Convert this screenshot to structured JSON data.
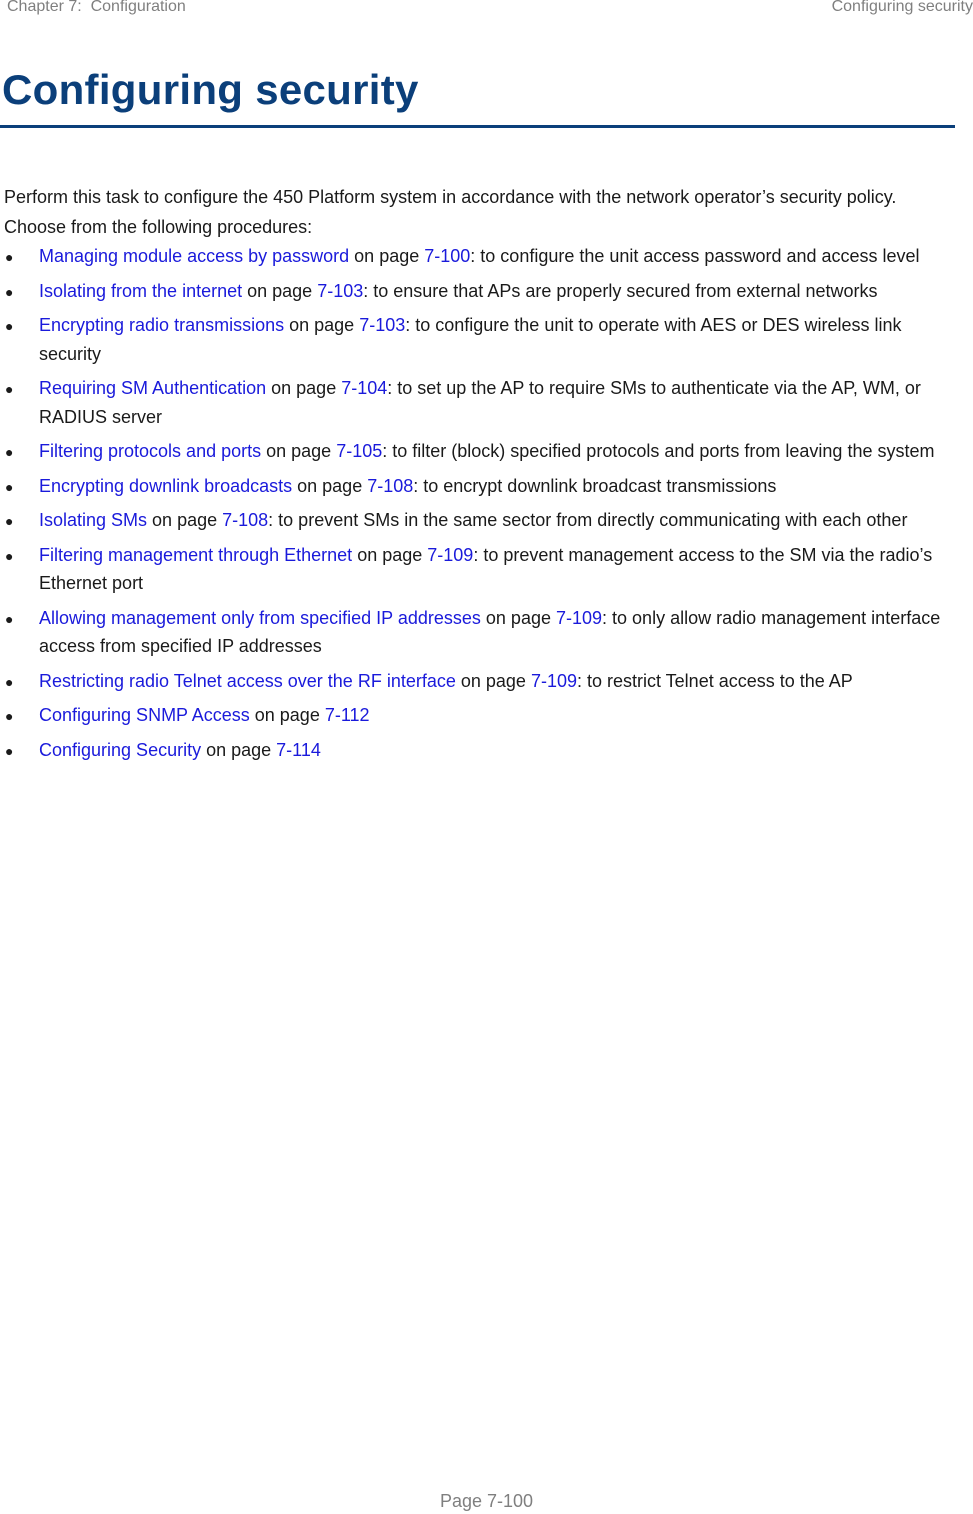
{
  "header": {
    "chapter": "Chapter 7:  Configuration",
    "section": "Configuring security"
  },
  "title": "Configuring security",
  "intro": "Perform this task to configure the 450 Platform system in accordance with the network operator’s security policy. Choose from the following procedures:",
  "on_page_text": " on page ",
  "procedures": [
    {
      "link": "Managing module access by password",
      "page": "7-100",
      "description": ": to configure the unit access password and access level"
    },
    {
      "link": "Isolating from the internet",
      "page": "7-103",
      "description": ": to ensure that APs are properly secured from external networks"
    },
    {
      "link": "Encrypting radio transmissions",
      "page": "7-103",
      "description": ": to configure the unit to operate with AES or DES wireless link security"
    },
    {
      "link": "Requiring SM Authentication",
      "page": "7-104",
      "description": ": to set up the AP to require SMs to authenticate via the AP, WM, or RADIUS server"
    },
    {
      "link": "Filtering protocols and ports",
      "page": "7-105",
      "description": ": to filter (block) specified protocols and ports from leaving the system"
    },
    {
      "link": "Encrypting downlink broadcasts",
      "page": "7-108",
      "description": ": to encrypt downlink broadcast transmissions"
    },
    {
      "link": "Isolating SMs",
      "page": "7-108",
      "description": ": to prevent SMs in the same sector from directly communicating with each other"
    },
    {
      "link": "Filtering management through Ethernet",
      "page": "7-109",
      "description": ": to prevent management access to the SM via the radio’s Ethernet port"
    },
    {
      "link": "Allowing management only from specified IP addresses",
      "page": "7-109",
      "description": ": to only allow radio management interface access from specified IP addresses"
    },
    {
      "link": "Restricting radio Telnet access over the RF interface",
      "page": "7-109",
      "description": ": to restrict Telnet access to the AP"
    },
    {
      "link": "Configuring SNMP Access",
      "page": "7-112",
      "description": ""
    },
    {
      "link": "Configuring Security",
      "page": "7-114",
      "description": ""
    }
  ],
  "footer": {
    "page_label": "Page 7-100"
  },
  "colors": {
    "title": "#0b3f7a",
    "link": "#1a1adb",
    "header_text": "#7f7f7f"
  }
}
